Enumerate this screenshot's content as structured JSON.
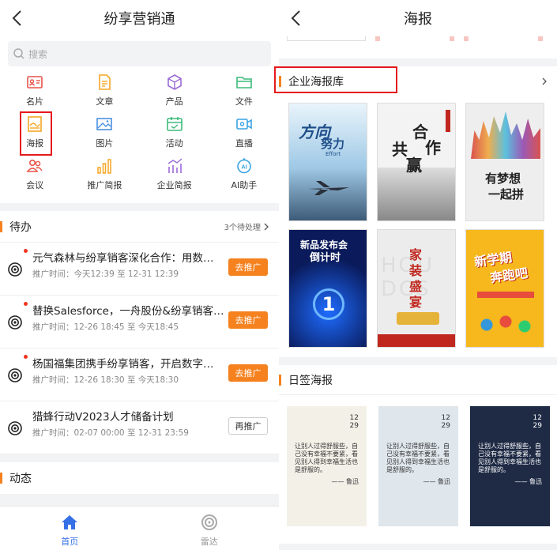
{
  "left": {
    "title": "纷享营销通",
    "search_placeholder": "搜索",
    "grid": [
      {
        "label": "名片",
        "icon": "card-icon",
        "color": "#e8534a"
      },
      {
        "label": "文章",
        "icon": "article-icon",
        "color": "#f5a623"
      },
      {
        "label": "产品",
        "icon": "product-icon",
        "color": "#9b6bd6"
      },
      {
        "label": "文件",
        "icon": "folder-icon",
        "color": "#3dbb7a"
      },
      {
        "label": "海报",
        "icon": "poster-icon",
        "color": "#f5a623"
      },
      {
        "label": "图片",
        "icon": "image-icon",
        "color": "#4a90e2"
      },
      {
        "label": "活动",
        "icon": "calendar-icon",
        "color": "#3dbb7a"
      },
      {
        "label": "直播",
        "icon": "video-icon",
        "color": "#3aa3e3"
      },
      {
        "label": "会议",
        "icon": "people-icon",
        "color": "#e8534a"
      },
      {
        "label": "推广简报",
        "icon": "bar-chart-icon",
        "color": "#f5a623"
      },
      {
        "label": "企业简报",
        "icon": "trend-chart-icon",
        "color": "#9b6bd6"
      },
      {
        "label": "AI助手",
        "icon": "ai-assistant-icon",
        "color": "#3aa3e3"
      }
    ],
    "todo": {
      "title": "待办",
      "pending": "3个待处理",
      "items": [
        {
          "title": "元气森林与纷享销客深化合作：用数…",
          "time": "推广时间：今天12:39 至 12-31 12:39",
          "btn": "去推广",
          "unread": true
        },
        {
          "title": "替换Salesforce，一舟股份&纷享销客…",
          "time": "推广时间：12-26 18:45 至 今天18:45",
          "btn": "去推广",
          "unread": true
        },
        {
          "title": "杨国福集团携手纷享销客，开启数字…",
          "time": "推广时间：12-26 18:30 至 今天18:30",
          "btn": "去推广",
          "unread": true
        },
        {
          "title": "猎蜂行动V2023人才储备计划",
          "time": "推广时间：02-07 00:00 至 12-31 23:59",
          "btn": "再推广",
          "unread": false
        }
      ]
    },
    "dynamic": {
      "title": "动态"
    },
    "tabs": [
      {
        "label": "首页"
      },
      {
        "label": "雷达"
      }
    ]
  },
  "right": {
    "title": "海报",
    "library": {
      "title": "企业海报库"
    },
    "posters": [
      {
        "name": "direction-effort-poster",
        "lines": [
          "方向",
          "努力",
          "Effort"
        ],
        "bg": "#bfe0f4"
      },
      {
        "name": "cooperation-win-poster",
        "lines": [
          "合",
          "作",
          "共",
          "赢"
        ],
        "bg": "#f3f3f3"
      },
      {
        "name": "dream-poster",
        "lines": [
          "有梦想",
          "一起拼"
        ],
        "bg": "#eeeeee"
      },
      {
        "name": "launch-event-poster",
        "lines": [
          "新品发布会",
          "倒计时",
          "1"
        ],
        "bg": "#0a1a5a"
      },
      {
        "name": "home-decor-poster",
        "lines": [
          "家",
          "装",
          "盛",
          "宴"
        ],
        "bg": "#ececec"
      },
      {
        "name": "new-semester-poster",
        "lines": [
          "新学期",
          "奔跑吧"
        ],
        "bg": "#f6b81c"
      }
    ],
    "daily": {
      "title": "日签海报",
      "cards": [
        {
          "m": "12",
          "d": "29",
          "quote": "让别人过得舒服些，自己没有幸福不要紧，看见别人得到幸福生活也是舒服的。",
          "author": "—— 鲁迅",
          "bg": "#f3f0e8",
          "fg": "#333333"
        },
        {
          "m": "12",
          "d": "29",
          "quote": "让别人过得舒服些，自己没有幸福不要紧，看见别人得到幸福生活也是舒服的。",
          "author": "—— 鲁迅",
          "bg": "#dfe6ec",
          "fg": "#333333"
        },
        {
          "m": "12",
          "d": "29",
          "quote": "让别人过得舒服些，自己没有幸福不要紧，看见别人得到幸福生活也是舒服的。",
          "author": "—— 鲁迅",
          "bg": "#1f2b45",
          "fg": "#ffffff"
        }
      ]
    }
  }
}
